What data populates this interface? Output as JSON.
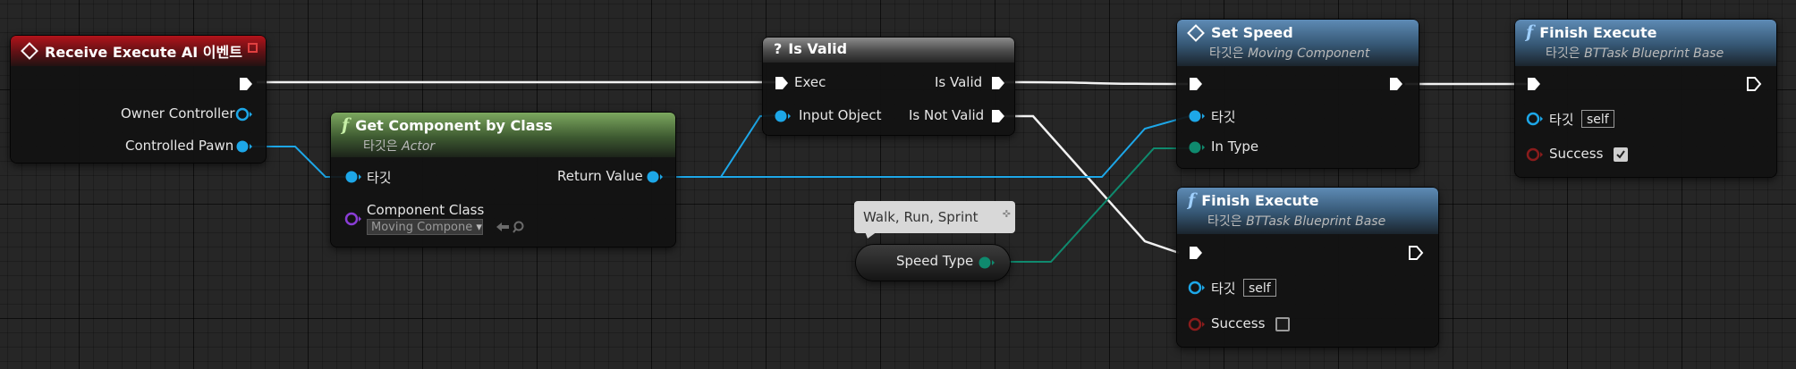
{
  "nodes": {
    "receive_execute": {
      "title": "Receive Execute AI 이벤트",
      "pins": [
        "Owner Controller",
        "Controlled Pawn"
      ]
    },
    "get_component": {
      "title": "Get Component by Class",
      "subtitle_prefix": "타깃은",
      "subtitle_target": "Actor",
      "pins": {
        "target": "타깃",
        "return_value": "Return Value",
        "component_class": "Component Class",
        "component_class_value": "Moving Compone"
      }
    },
    "is_valid": {
      "title": "Is Valid",
      "pins": {
        "exec": "Exec",
        "is_valid": "Is Valid",
        "input_object": "Input Object",
        "is_not_valid": "Is Not Valid"
      }
    },
    "speed_type": {
      "label": "Speed Type"
    },
    "set_speed": {
      "title": "Set Speed",
      "subtitle_prefix": "타깃은",
      "subtitle_target": "Moving Component",
      "pins": {
        "target": "타깃",
        "in_type": "In Type"
      }
    },
    "finish_fail": {
      "title": "Finish Execute",
      "subtitle_prefix": "타깃은",
      "subtitle_target": "BTTask Blueprint Base",
      "pins": {
        "target": "타깃",
        "target_value": "self",
        "success": "Success",
        "success_checked": false
      }
    },
    "finish_success": {
      "title": "Finish Execute",
      "subtitle_prefix": "타깃은",
      "subtitle_target": "BTTask Blueprint Base",
      "pins": {
        "target": "타깃",
        "target_value": "self",
        "success": "Success",
        "success_checked": true
      }
    }
  },
  "comment": {
    "text": "Walk, Run, Sprint"
  },
  "colors": {
    "exec_wire": "#f2f2f2",
    "object_pin": "#1da7e8",
    "enum_pin": "#0f8a6e",
    "class_pin": "#8a3dd6",
    "bool_pin": "#8a1c1c",
    "event_header": "#b3131a",
    "pure_function_header": "#7ca85f",
    "call_function_header": "#5e8bb5",
    "macro_header": "#8c8c8c"
  }
}
